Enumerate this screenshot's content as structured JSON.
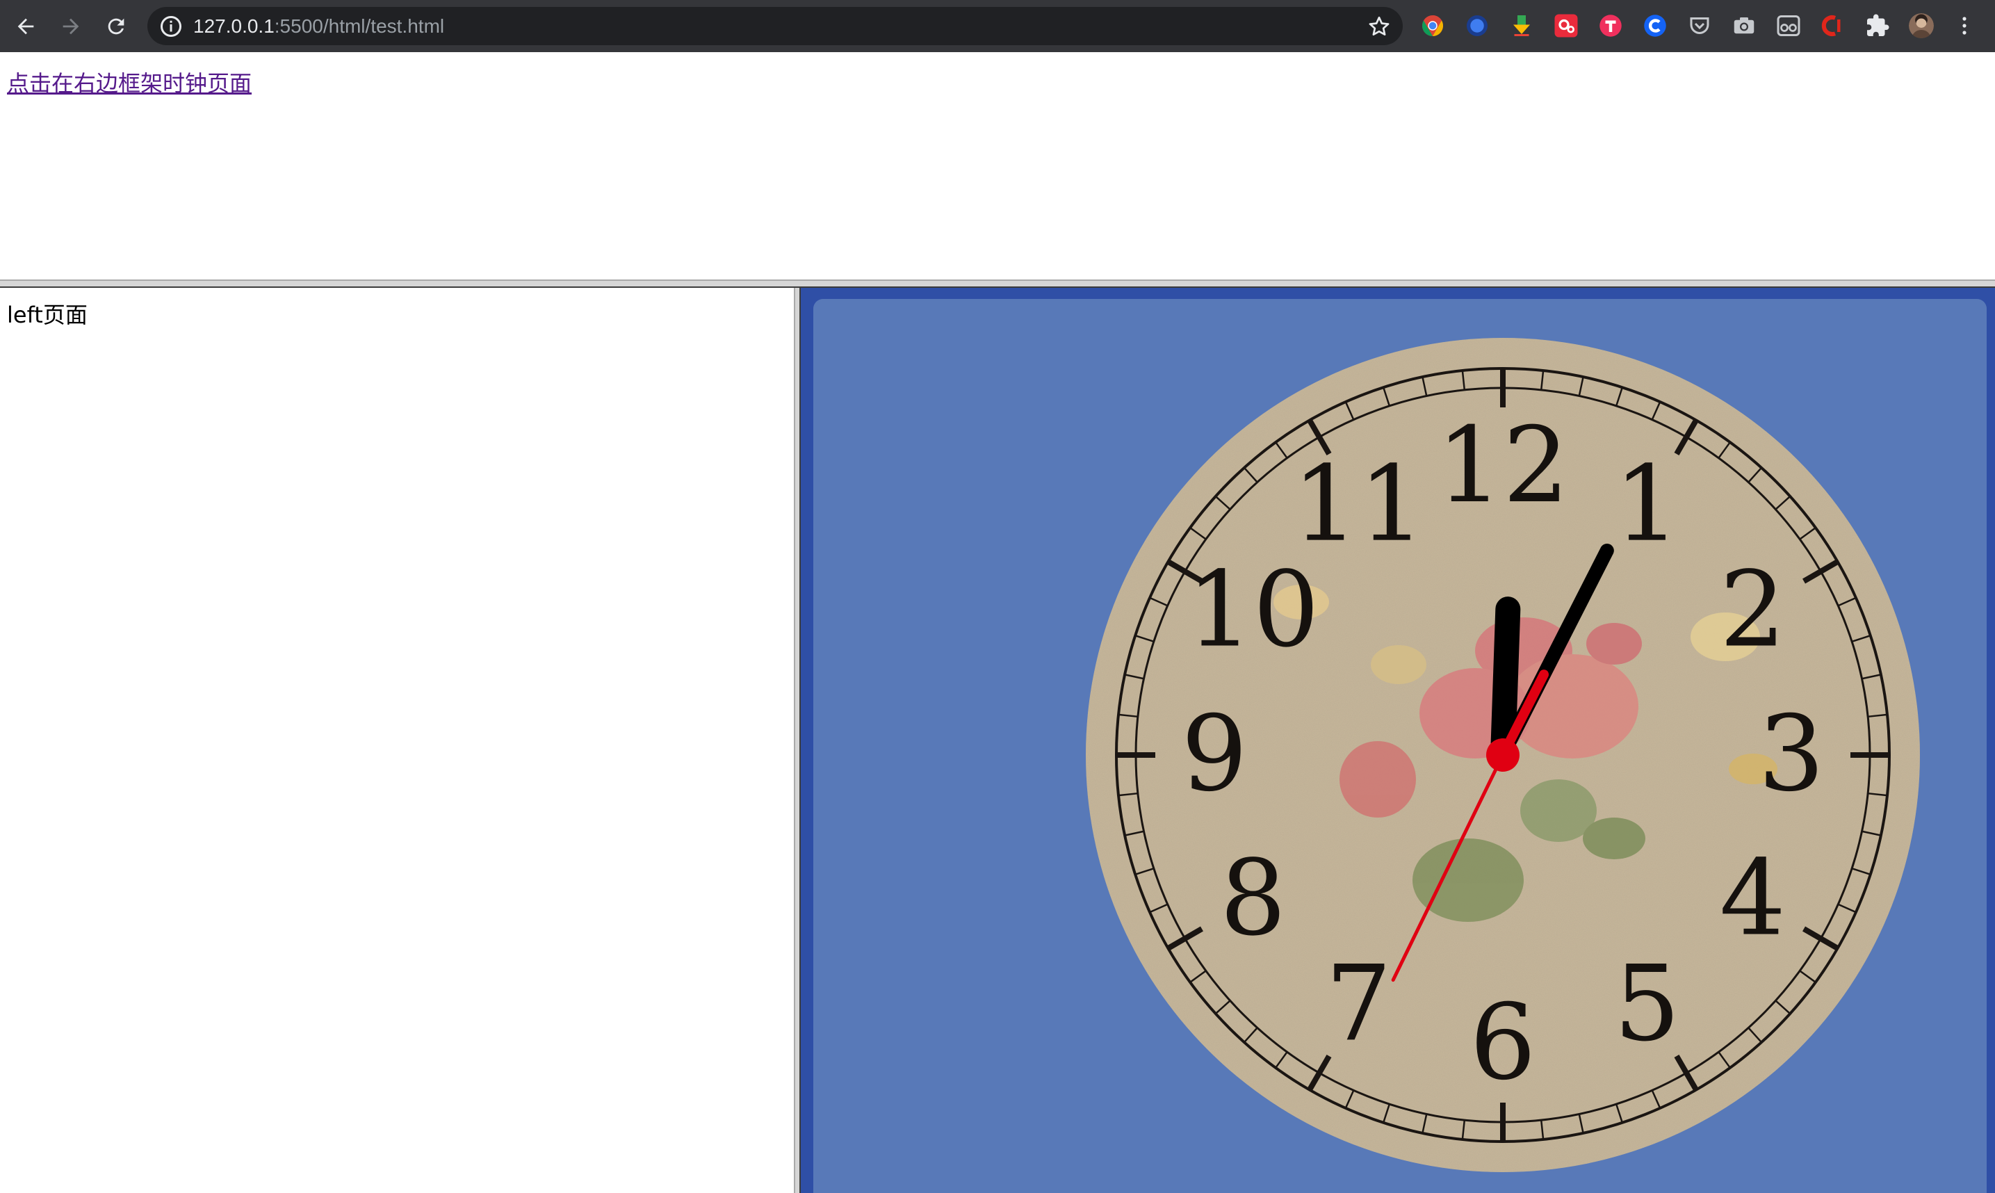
{
  "browser": {
    "url_host": "127.0.0.1",
    "url_rest": ":5500/html/test.html",
    "extensions": [
      "chrome-icon",
      "circle-blue-icon",
      "download-arrow-icon",
      "red-gear-icon",
      "pink-t-icon",
      "blue-c-icon",
      "pocket-icon",
      "camera-icon",
      "glasses-icon",
      "red-c-icon",
      "puzzle-icon",
      "profile-avatar"
    ]
  },
  "top_frame": {
    "link_text": "点击在右边框架时钟页面"
  },
  "left_frame": {
    "text": "left页面"
  },
  "clock": {
    "numerals": [
      "12",
      "1",
      "2",
      "3",
      "4",
      "5",
      "6",
      "7",
      "8",
      "9",
      "10",
      "11"
    ],
    "hour_hand_angle": 2,
    "minute_hand_angle": 27,
    "second_hand_angle": 206,
    "colors": {
      "panel": "#5879b8",
      "frame_bg": "#2f4fa6",
      "face": "#c7b79a",
      "second_hand": "#e00012",
      "hands": "#000000"
    }
  }
}
